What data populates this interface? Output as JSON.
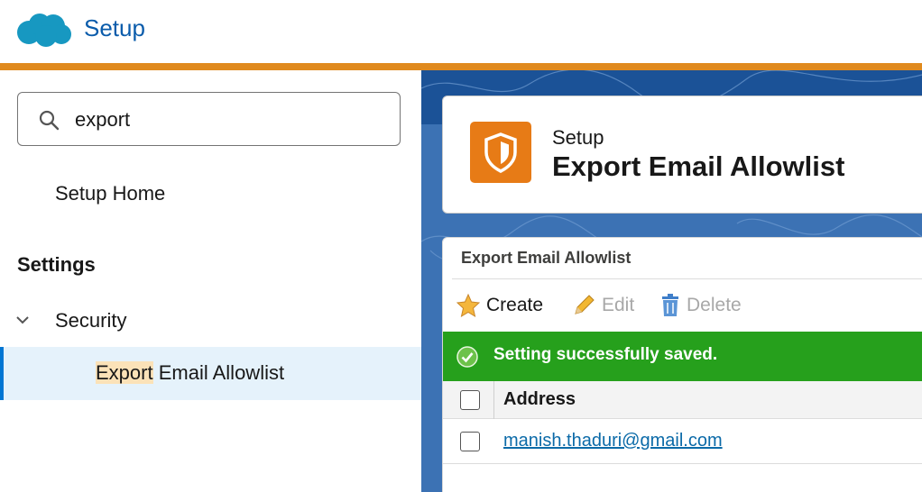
{
  "header": {
    "app_title": "Setup",
    "accent_color": "#e08a1e",
    "logo_icon": "salesforce-cloud-icon"
  },
  "sidebar": {
    "search": {
      "value": "export",
      "icon": "search-icon"
    },
    "setup_home": "Setup Home",
    "section_heading": "Settings",
    "security": {
      "label": "Security",
      "icon": "chevron-down-icon"
    },
    "active_item": {
      "highlight": "Export",
      "rest": " Email Allowlist"
    }
  },
  "page_header": {
    "eyebrow": "Setup",
    "title": "Export Email Allowlist",
    "icon": "shield-icon",
    "icon_color": "#e77b16"
  },
  "content": {
    "title": "Export Email Allowlist",
    "toolbar": {
      "create": "Create",
      "edit": "Edit",
      "delete": "Delete"
    },
    "success_message": "Setting successfully saved.",
    "success_color": "#26a01c",
    "table": {
      "columns": [
        "Address"
      ],
      "rows": [
        {
          "address": "manish.thaduri@gmail.com"
        }
      ]
    }
  }
}
